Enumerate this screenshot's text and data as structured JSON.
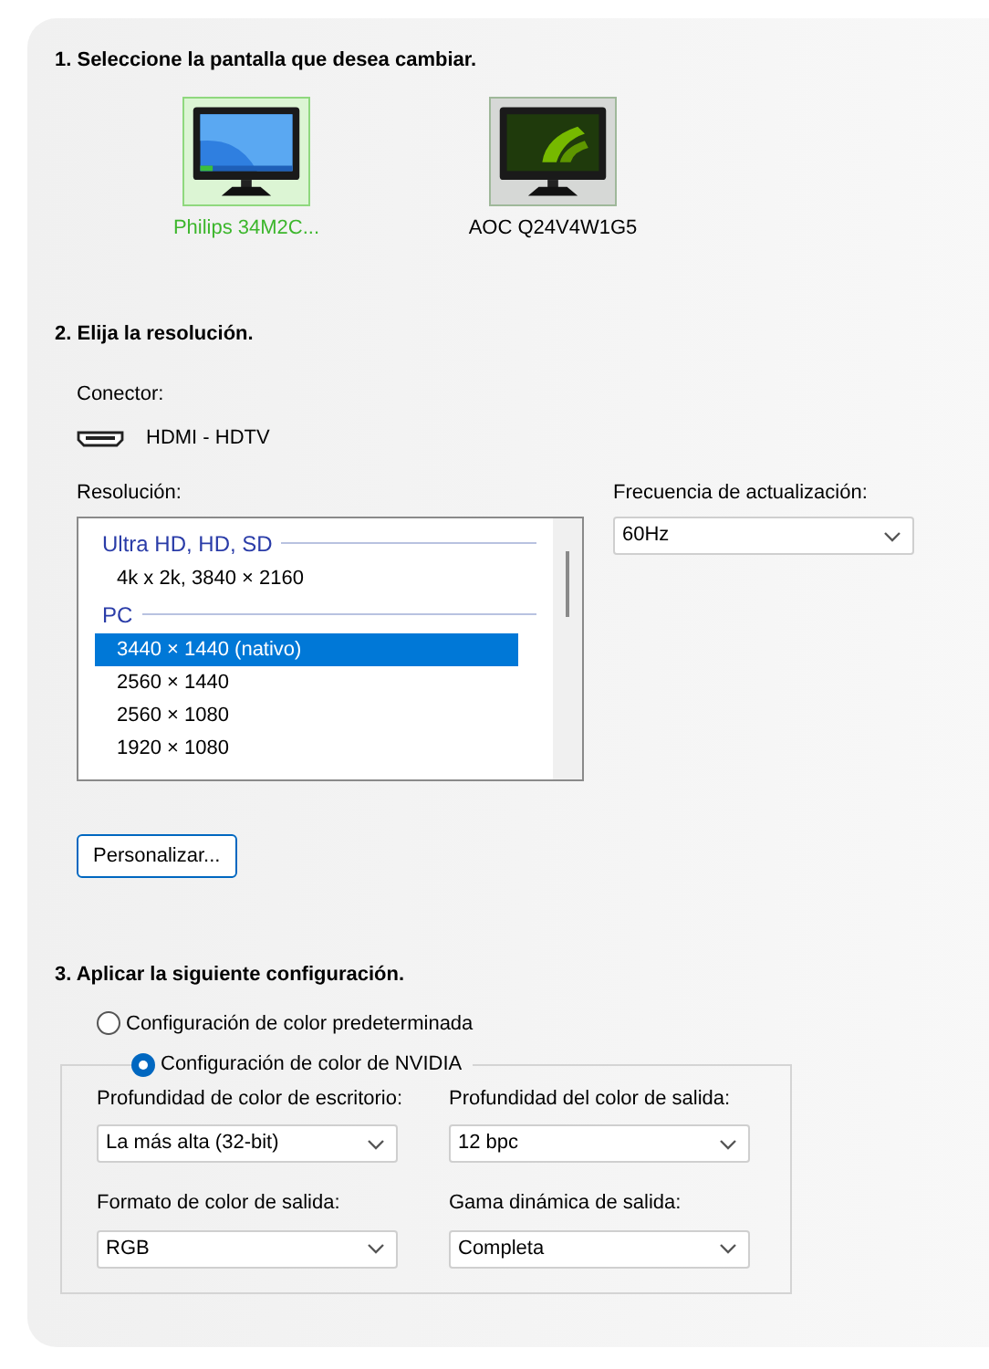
{
  "section_1": {
    "heading": "1. Seleccione la pantalla que desea cambiar.",
    "displays": [
      {
        "name": "Philips 34M2C...",
        "selected": true,
        "kind": "desktop"
      },
      {
        "name": "AOC Q24V4W1G5",
        "selected": false,
        "kind": "nvidia"
      }
    ]
  },
  "section_2": {
    "heading": "2. Elija la resolución.",
    "connector_label": "Conector:",
    "connector": "HDMI - HDTV",
    "resolution_label": "Resolución:",
    "resolutions": [
      {
        "kind": "group",
        "label": "Ultra HD, HD, SD"
      },
      {
        "kind": "item",
        "label": "4k x 2k, 3840 × 2160",
        "selected": false
      },
      {
        "kind": "group",
        "label": "PC"
      },
      {
        "kind": "item",
        "label": "3440 × 1440 (nativo)",
        "selected": true
      },
      {
        "kind": "item",
        "label": "2560 × 1440",
        "selected": false
      },
      {
        "kind": "item",
        "label": "2560 × 1080",
        "selected": false
      },
      {
        "kind": "item",
        "label": "1920 × 1080",
        "selected": false
      }
    ],
    "refresh_label": "Frecuencia de actualización:",
    "refresh_value": "60Hz",
    "customize_button": "Personalizar..."
  },
  "section_3": {
    "heading": "3. Aplicar la siguiente configuración.",
    "options": [
      {
        "label": "Configuración de color predeterminada",
        "selected": false
      },
      {
        "label": "Configuración de color de NVIDIA",
        "selected": true
      }
    ],
    "settings": [
      {
        "label": "Profundidad de color de escritorio:",
        "value": "La más alta (32-bit)"
      },
      {
        "label": "Profundidad del color de salida:",
        "value": "12 bpc"
      },
      {
        "label": "Formato de color de salida:",
        "value": "RGB"
      },
      {
        "label": "Gama dinámica de salida:",
        "value": "Completa"
      }
    ]
  }
}
